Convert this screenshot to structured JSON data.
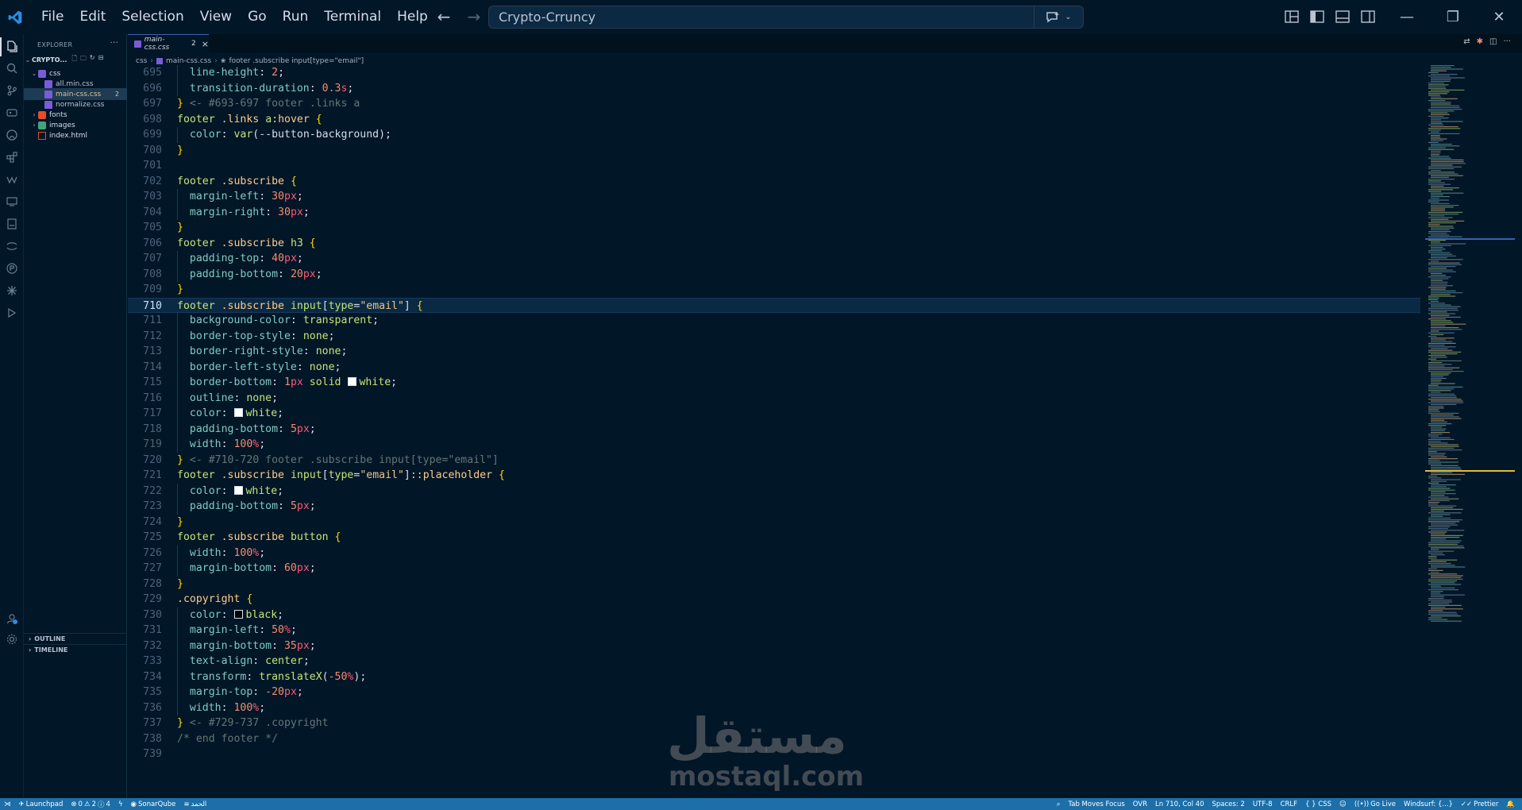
{
  "menu": [
    "File",
    "Edit",
    "Selection",
    "View",
    "Go",
    "Run",
    "Terminal",
    "Help"
  ],
  "command_center": {
    "text": "Crypto-Crruncy"
  },
  "sidebar": {
    "title": "EXPLORER",
    "folder": "CRYPTO...",
    "items": [
      {
        "name": "css",
        "type": "folder-open",
        "indent": 1
      },
      {
        "name": "all.min.css",
        "type": "css",
        "indent": 2
      },
      {
        "name": "main-css.css",
        "type": "css",
        "indent": 2,
        "badge": "2",
        "selected": true
      },
      {
        "name": "normalize.css",
        "type": "css",
        "indent": 2
      },
      {
        "name": "fonts",
        "type": "folder",
        "indent": 1
      },
      {
        "name": "images",
        "type": "folder",
        "indent": 1
      },
      {
        "name": "index.html",
        "type": "html",
        "indent": 1
      }
    ],
    "outline": "OUTLINE",
    "timeline": "TIMELINE"
  },
  "tab": {
    "name": "main-css.css",
    "badge": "2",
    "close": "×"
  },
  "breadcrumb": [
    "css",
    "main-css.css",
    "footer .subscribe input[type=\"email\"]"
  ],
  "editor": {
    "current_line": 710,
    "lines": [
      {
        "n": 695,
        "tokens": [
          [
            "t-prop",
            "  line-height"
          ],
          [
            "t-punct",
            ": "
          ],
          [
            "t-num",
            "2"
          ],
          [
            "t-punct",
            ";"
          ]
        ]
      },
      {
        "n": 696,
        "tokens": [
          [
            "t-prop",
            "  transition-duration"
          ],
          [
            "t-punct",
            ": "
          ],
          [
            "t-num",
            "0.3"
          ],
          [
            "t-unit",
            "s"
          ],
          [
            "t-punct",
            ";"
          ]
        ]
      },
      {
        "n": 697,
        "tokens": [
          [
            "t-brace",
            "}"
          ],
          [
            "t-cmt",
            " <- #693-697 footer .links a"
          ]
        ]
      },
      {
        "n": 698,
        "tokens": [
          [
            "t-sel",
            "footer"
          ],
          [
            "t-punct",
            " "
          ],
          [
            "t-cls",
            ".links"
          ],
          [
            "t-punct",
            " "
          ],
          [
            "t-sel",
            "a"
          ],
          [
            "t-cls",
            ":hover"
          ],
          [
            "t-punct",
            " "
          ],
          [
            "t-brace",
            "{"
          ]
        ]
      },
      {
        "n": 699,
        "tokens": [
          [
            "t-prop",
            "  color"
          ],
          [
            "t-punct",
            ": "
          ],
          [
            "t-fn",
            "var"
          ],
          [
            "t-punct",
            "(--button-background);"
          ]
        ]
      },
      {
        "n": 700,
        "tokens": [
          [
            "t-brace",
            "}"
          ]
        ]
      },
      {
        "n": 701,
        "tokens": []
      },
      {
        "n": 702,
        "tokens": [
          [
            "t-sel",
            "footer"
          ],
          [
            "t-punct",
            " "
          ],
          [
            "t-cls",
            ".subscribe"
          ],
          [
            "t-punct",
            " "
          ],
          [
            "t-brace",
            "{"
          ]
        ]
      },
      {
        "n": 703,
        "tokens": [
          [
            "t-prop",
            "  margin-left"
          ],
          [
            "t-punct",
            ": "
          ],
          [
            "t-num",
            "30"
          ],
          [
            "t-unit",
            "px"
          ],
          [
            "t-punct",
            ";"
          ]
        ]
      },
      {
        "n": 704,
        "tokens": [
          [
            "t-prop",
            "  margin-right"
          ],
          [
            "t-punct",
            ": "
          ],
          [
            "t-num",
            "30"
          ],
          [
            "t-unit",
            "px"
          ],
          [
            "t-punct",
            ";"
          ]
        ]
      },
      {
        "n": 705,
        "tokens": [
          [
            "t-brace",
            "}"
          ]
        ]
      },
      {
        "n": 706,
        "tokens": [
          [
            "t-sel",
            "footer"
          ],
          [
            "t-punct",
            " "
          ],
          [
            "t-cls",
            ".subscribe"
          ],
          [
            "t-punct",
            " "
          ],
          [
            "t-sel",
            "h3"
          ],
          [
            "t-punct",
            " "
          ],
          [
            "t-brace",
            "{"
          ]
        ]
      },
      {
        "n": 707,
        "tokens": [
          [
            "t-prop",
            "  padding-top"
          ],
          [
            "t-punct",
            ": "
          ],
          [
            "t-num",
            "40"
          ],
          [
            "t-unit",
            "px"
          ],
          [
            "t-punct",
            ";"
          ]
        ]
      },
      {
        "n": 708,
        "tokens": [
          [
            "t-prop",
            "  padding-bottom"
          ],
          [
            "t-punct",
            ": "
          ],
          [
            "t-num",
            "20"
          ],
          [
            "t-unit",
            "px"
          ],
          [
            "t-punct",
            ";"
          ]
        ]
      },
      {
        "n": 709,
        "tokens": [
          [
            "t-brace",
            "}"
          ]
        ]
      },
      {
        "n": 710,
        "tokens": [
          [
            "t-sel",
            "footer"
          ],
          [
            "t-punct",
            " "
          ],
          [
            "t-cls",
            ".subscribe"
          ],
          [
            "t-punct",
            " "
          ],
          [
            "t-sel",
            "input"
          ],
          [
            "t-punct",
            "["
          ],
          [
            "t-sel",
            "type"
          ],
          [
            "t-punct",
            "="
          ],
          [
            "t-str",
            "\"email\""
          ],
          [
            "t-punct",
            "] "
          ],
          [
            "t-brace",
            "{"
          ]
        ]
      },
      {
        "n": 711,
        "tokens": [
          [
            "t-prop",
            "  background-color"
          ],
          [
            "t-punct",
            ": "
          ],
          [
            "t-val",
            "transparent"
          ],
          [
            "t-punct",
            ";"
          ]
        ]
      },
      {
        "n": 712,
        "tokens": [
          [
            "t-prop",
            "  border-top-style"
          ],
          [
            "t-punct",
            ": "
          ],
          [
            "t-val",
            "none"
          ],
          [
            "t-punct",
            ";"
          ]
        ]
      },
      {
        "n": 713,
        "tokens": [
          [
            "t-prop",
            "  border-right-style"
          ],
          [
            "t-punct",
            ": "
          ],
          [
            "t-val",
            "none"
          ],
          [
            "t-punct",
            ";"
          ]
        ]
      },
      {
        "n": 714,
        "tokens": [
          [
            "t-prop",
            "  border-left-style"
          ],
          [
            "t-punct",
            ": "
          ],
          [
            "t-val",
            "none"
          ],
          [
            "t-punct",
            ";"
          ]
        ]
      },
      {
        "n": 715,
        "tokens": [
          [
            "t-prop",
            "  border-bottom"
          ],
          [
            "t-punct",
            ": "
          ],
          [
            "t-num",
            "1"
          ],
          [
            "t-unit",
            "px"
          ],
          [
            "t-punct",
            " "
          ],
          [
            "t-val",
            "solid"
          ],
          [
            "t-punct",
            " "
          ],
          [
            "swatch",
            "#ffffff"
          ],
          [
            "t-val",
            "white"
          ],
          [
            "t-punct",
            ";"
          ]
        ]
      },
      {
        "n": 716,
        "tokens": [
          [
            "t-prop",
            "  outline"
          ],
          [
            "t-punct",
            ": "
          ],
          [
            "t-val",
            "none"
          ],
          [
            "t-punct",
            ";"
          ]
        ]
      },
      {
        "n": 717,
        "tokens": [
          [
            "t-prop",
            "  color"
          ],
          [
            "t-punct",
            ": "
          ],
          [
            "swatch",
            "#ffffff"
          ],
          [
            "t-val",
            "white"
          ],
          [
            "t-punct",
            ";"
          ]
        ]
      },
      {
        "n": 718,
        "tokens": [
          [
            "t-prop",
            "  padding-bottom"
          ],
          [
            "t-punct",
            ": "
          ],
          [
            "t-num",
            "5"
          ],
          [
            "t-unit",
            "px"
          ],
          [
            "t-punct",
            ";"
          ]
        ]
      },
      {
        "n": 719,
        "tokens": [
          [
            "t-prop",
            "  width"
          ],
          [
            "t-punct",
            ": "
          ],
          [
            "t-num",
            "100"
          ],
          [
            "t-unit",
            "%"
          ],
          [
            "t-punct",
            ";"
          ]
        ]
      },
      {
        "n": 720,
        "tokens": [
          [
            "t-brace",
            "}"
          ],
          [
            "t-cmt",
            " <- #710-720 footer .subscribe input[type=\"email\"]"
          ]
        ]
      },
      {
        "n": 721,
        "tokens": [
          [
            "t-sel",
            "footer"
          ],
          [
            "t-punct",
            " "
          ],
          [
            "t-cls",
            ".subscribe"
          ],
          [
            "t-punct",
            " "
          ],
          [
            "t-sel",
            "input"
          ],
          [
            "t-punct",
            "["
          ],
          [
            "t-sel",
            "type"
          ],
          [
            "t-punct",
            "="
          ],
          [
            "t-str",
            "\"email\""
          ],
          [
            "t-punct",
            "]"
          ],
          [
            "t-cls",
            "::placeholder"
          ],
          [
            "t-punct",
            " "
          ],
          [
            "t-brace",
            "{"
          ]
        ]
      },
      {
        "n": 722,
        "tokens": [
          [
            "t-prop",
            "  color"
          ],
          [
            "t-punct",
            ": "
          ],
          [
            "swatch",
            "#ffffff"
          ],
          [
            "t-val",
            "white"
          ],
          [
            "t-punct",
            ";"
          ]
        ]
      },
      {
        "n": 723,
        "tokens": [
          [
            "t-prop",
            "  padding-bottom"
          ],
          [
            "t-punct",
            ": "
          ],
          [
            "t-num",
            "5"
          ],
          [
            "t-unit",
            "px"
          ],
          [
            "t-punct",
            ";"
          ]
        ]
      },
      {
        "n": 724,
        "tokens": [
          [
            "t-brace",
            "}"
          ]
        ]
      },
      {
        "n": 725,
        "tokens": [
          [
            "t-sel",
            "footer"
          ],
          [
            "t-punct",
            " "
          ],
          [
            "t-cls",
            ".subscribe"
          ],
          [
            "t-punct",
            " "
          ],
          [
            "t-sel",
            "button"
          ],
          [
            "t-punct",
            " "
          ],
          [
            "t-brace",
            "{"
          ]
        ]
      },
      {
        "n": 726,
        "tokens": [
          [
            "t-prop",
            "  width"
          ],
          [
            "t-punct",
            ": "
          ],
          [
            "t-num",
            "100"
          ],
          [
            "t-unit",
            "%"
          ],
          [
            "t-punct",
            ";"
          ]
        ]
      },
      {
        "n": 727,
        "tokens": [
          [
            "t-prop",
            "  margin-bottom"
          ],
          [
            "t-punct",
            ": "
          ],
          [
            "t-num",
            "60"
          ],
          [
            "t-unit",
            "px"
          ],
          [
            "t-punct",
            ";"
          ]
        ]
      },
      {
        "n": 728,
        "tokens": [
          [
            "t-brace",
            "}"
          ]
        ]
      },
      {
        "n": 729,
        "tokens": [
          [
            "t-cls",
            ".copyright"
          ],
          [
            "t-punct",
            " "
          ],
          [
            "t-brace",
            "{"
          ]
        ]
      },
      {
        "n": 730,
        "tokens": [
          [
            "t-prop",
            "  color"
          ],
          [
            "t-punct",
            ": "
          ],
          [
            "swatch",
            "#000000"
          ],
          [
            "t-val",
            "black"
          ],
          [
            "t-punct",
            ";"
          ]
        ]
      },
      {
        "n": 731,
        "tokens": [
          [
            "t-prop",
            "  margin-left"
          ],
          [
            "t-punct",
            ": "
          ],
          [
            "t-num",
            "50"
          ],
          [
            "t-unit",
            "%"
          ],
          [
            "t-punct",
            ";"
          ]
        ]
      },
      {
        "n": 732,
        "tokens": [
          [
            "t-prop",
            "  margin-bottom"
          ],
          [
            "t-punct",
            ": "
          ],
          [
            "t-num",
            "35"
          ],
          [
            "t-unit",
            "px"
          ],
          [
            "t-punct",
            ";"
          ]
        ]
      },
      {
        "n": 733,
        "tokens": [
          [
            "t-prop",
            "  text-align"
          ],
          [
            "t-punct",
            ": "
          ],
          [
            "t-val",
            "center"
          ],
          [
            "t-punct",
            ";"
          ]
        ]
      },
      {
        "n": 734,
        "tokens": [
          [
            "t-prop",
            "  transform"
          ],
          [
            "t-punct",
            ": "
          ],
          [
            "t-fn",
            "translateX"
          ],
          [
            "t-punct",
            "("
          ],
          [
            "t-num",
            "-50"
          ],
          [
            "t-unit",
            "%"
          ],
          [
            "t-punct",
            ");"
          ]
        ]
      },
      {
        "n": 735,
        "tokens": [
          [
            "t-prop",
            "  margin-top"
          ],
          [
            "t-punct",
            ": "
          ],
          [
            "t-num",
            "-20"
          ],
          [
            "t-unit",
            "px"
          ],
          [
            "t-punct",
            ";"
          ]
        ]
      },
      {
        "n": 736,
        "tokens": [
          [
            "t-prop",
            "  width"
          ],
          [
            "t-punct",
            ": "
          ],
          [
            "t-num",
            "100"
          ],
          [
            "t-unit",
            "%"
          ],
          [
            "t-punct",
            ";"
          ]
        ]
      },
      {
        "n": 737,
        "tokens": [
          [
            "t-brace",
            "}"
          ],
          [
            "t-cmt",
            " <- #729-737 .copyright"
          ]
        ]
      },
      {
        "n": 738,
        "tokens": [
          [
            "t-cmt",
            "/* end footer */"
          ]
        ]
      },
      {
        "n": 739,
        "tokens": []
      }
    ]
  },
  "watermark": {
    "arabic": "مستقل",
    "latin": "mostaql.com"
  },
  "statusbar": {
    "left": [
      "Launchpad",
      "0",
      "2",
      "4",
      "SonarQube",
      "الحمد"
    ],
    "right": [
      "Tab Moves Focus",
      "OVR",
      "Ln 710, Col 40",
      "Spaces: 2",
      "UTF-8",
      "CRLF",
      "{ } CSS",
      "Go Live",
      "Windsurf: {...}",
      "Prettier"
    ]
  },
  "colors": {
    "background": "#011627",
    "statusbar": "#1c6fa8",
    "accent": "#3b61b0"
  }
}
